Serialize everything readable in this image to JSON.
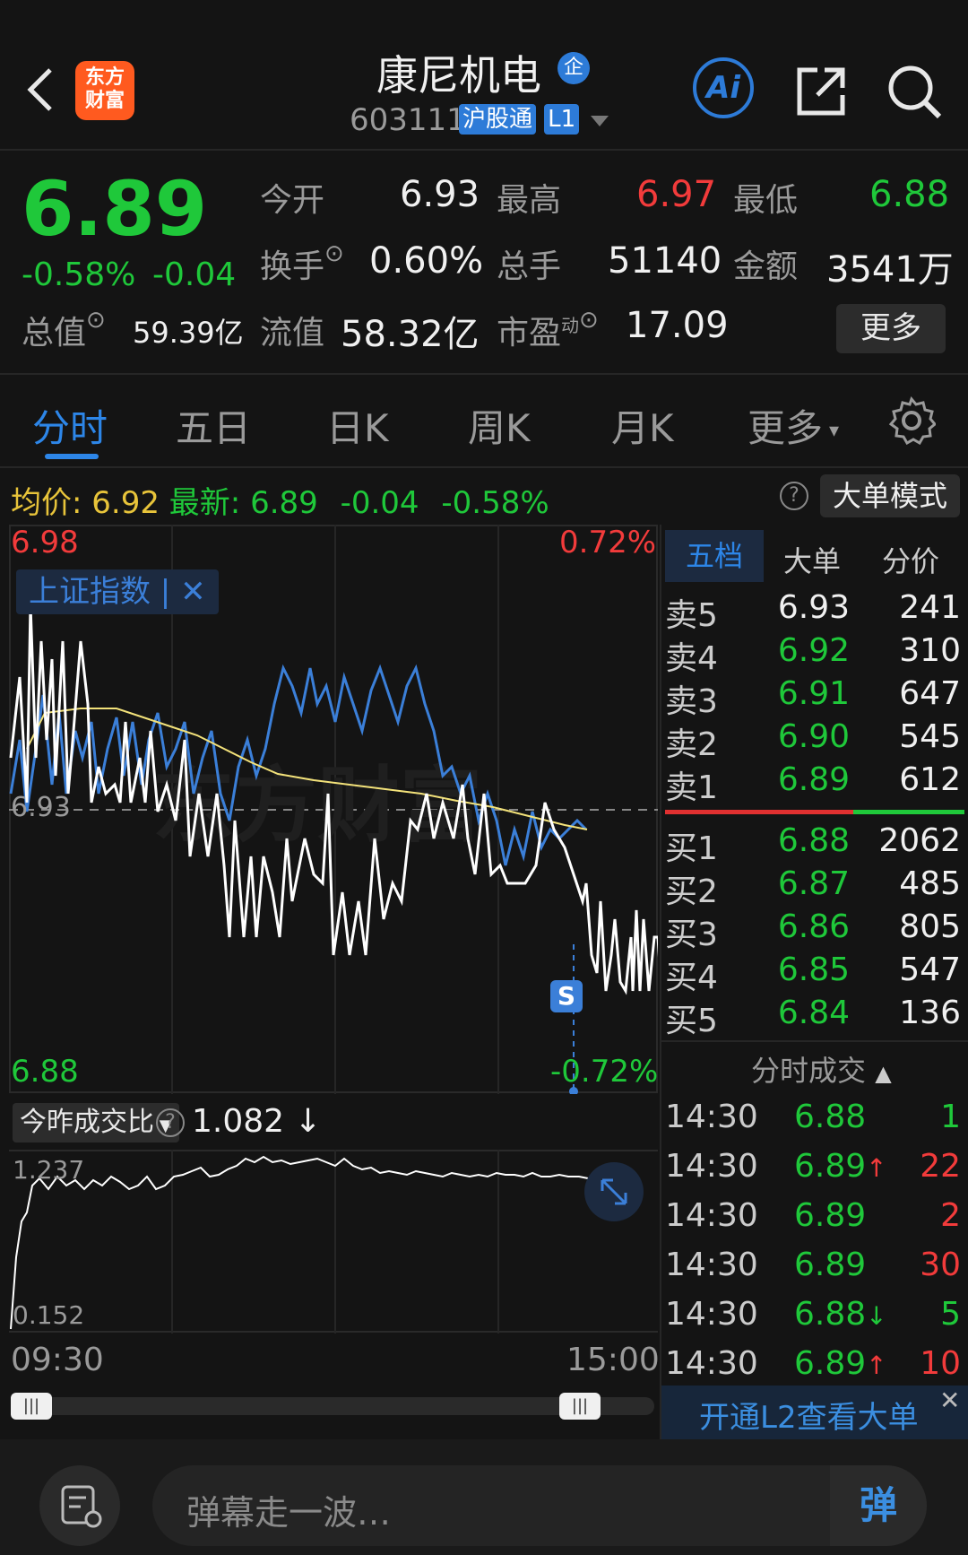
{
  "header": {
    "back_label": "<",
    "logo_text_1": "东方",
    "logo_text_2": "财富",
    "stock_name": "康尼机电",
    "badge": "企",
    "stock_code": "603111",
    "market_tag": "沪股通",
    "level_tag": "L1",
    "ai_label": "Ai"
  },
  "quote": {
    "price": "6.89",
    "change_pct": "-0.58%",
    "change": "-0.04",
    "open_label": "今开",
    "open": "6.93",
    "high_label": "最高",
    "high": "6.97",
    "low_label": "最低",
    "low": "6.88",
    "turnover_label": "换手",
    "turnover": "0.60%",
    "volume_label": "总手",
    "volume": "51140",
    "amount_label": "金额",
    "amount": "3541万",
    "total_cap_label": "总值",
    "total_cap": "59.39亿",
    "float_cap_label": "流值",
    "float_cap": "58.32亿",
    "pe_label": "市盈",
    "pe_sup": "动",
    "pe": "17.09",
    "more_label": "更多"
  },
  "tabs": [
    "分时",
    "五日",
    "日K",
    "周K",
    "月K",
    "更多"
  ],
  "infobar": {
    "avg_label": "均价:",
    "avg": "6.92",
    "latest_label": "最新:",
    "latest": "6.89",
    "change": "-0.04",
    "change_pct": "-0.58%",
    "big_order_mode": "大单模式"
  },
  "chart": {
    "max_price": "6.98",
    "max_pct": "0.72%",
    "mid_price": "6.93",
    "min_price": "6.88",
    "min_pct": "-0.72%",
    "index_overlay": "上证指数",
    "signal": "S",
    "start_time": "09:30",
    "end_time": "15:00",
    "ratio_label": "今昨成交比",
    "ratio_value": "1.082",
    "ratio_max": "1.237",
    "ratio_min": "0.152",
    "colors": {
      "price": "#ffffff",
      "avg": "#f3e27a",
      "index": "#3b7fd8"
    }
  },
  "orderbook": {
    "tabs": [
      "五档",
      "大单",
      "分价"
    ],
    "asks": [
      {
        "label": "卖5",
        "price": "6.93",
        "vol": "241",
        "color": "white"
      },
      {
        "label": "卖4",
        "price": "6.92",
        "vol": "310",
        "color": "green"
      },
      {
        "label": "卖3",
        "price": "6.91",
        "vol": "647",
        "color": "green"
      },
      {
        "label": "卖2",
        "price": "6.90",
        "vol": "545",
        "color": "green"
      },
      {
        "label": "卖1",
        "price": "6.89",
        "vol": "612",
        "color": "green"
      }
    ],
    "bids": [
      {
        "label": "买1",
        "price": "6.88",
        "vol": "2062",
        "color": "green"
      },
      {
        "label": "买2",
        "price": "6.87",
        "vol": "485",
        "color": "green"
      },
      {
        "label": "买3",
        "price": "6.86",
        "vol": "805",
        "color": "green"
      },
      {
        "label": "买4",
        "price": "6.85",
        "vol": "547",
        "color": "green"
      },
      {
        "label": "买5",
        "price": "6.84",
        "vol": "136",
        "color": "green"
      }
    ],
    "ticks_title": "分时成交",
    "ticks": [
      {
        "time": "14:30",
        "price": "6.88",
        "arrow": "",
        "vol": "1",
        "vcolor": "green"
      },
      {
        "time": "14:30",
        "price": "6.89",
        "arrow": "↑",
        "vol": "22",
        "vcolor": "red"
      },
      {
        "time": "14:30",
        "price": "6.89",
        "arrow": "",
        "vol": "2",
        "vcolor": "red"
      },
      {
        "time": "14:30",
        "price": "6.89",
        "arrow": "",
        "vol": "30",
        "vcolor": "red"
      },
      {
        "time": "14:30",
        "price": "6.88",
        "arrow": "↓",
        "vol": "5",
        "vcolor": "green"
      },
      {
        "time": "14:30",
        "price": "6.89",
        "arrow": "↑",
        "vol": "10",
        "vcolor": "red"
      }
    ],
    "l2_promo": "开通L2查看大单"
  },
  "footer": {
    "comment_placeholder": "弹幕走一波…",
    "danmu_label": "弹"
  }
}
